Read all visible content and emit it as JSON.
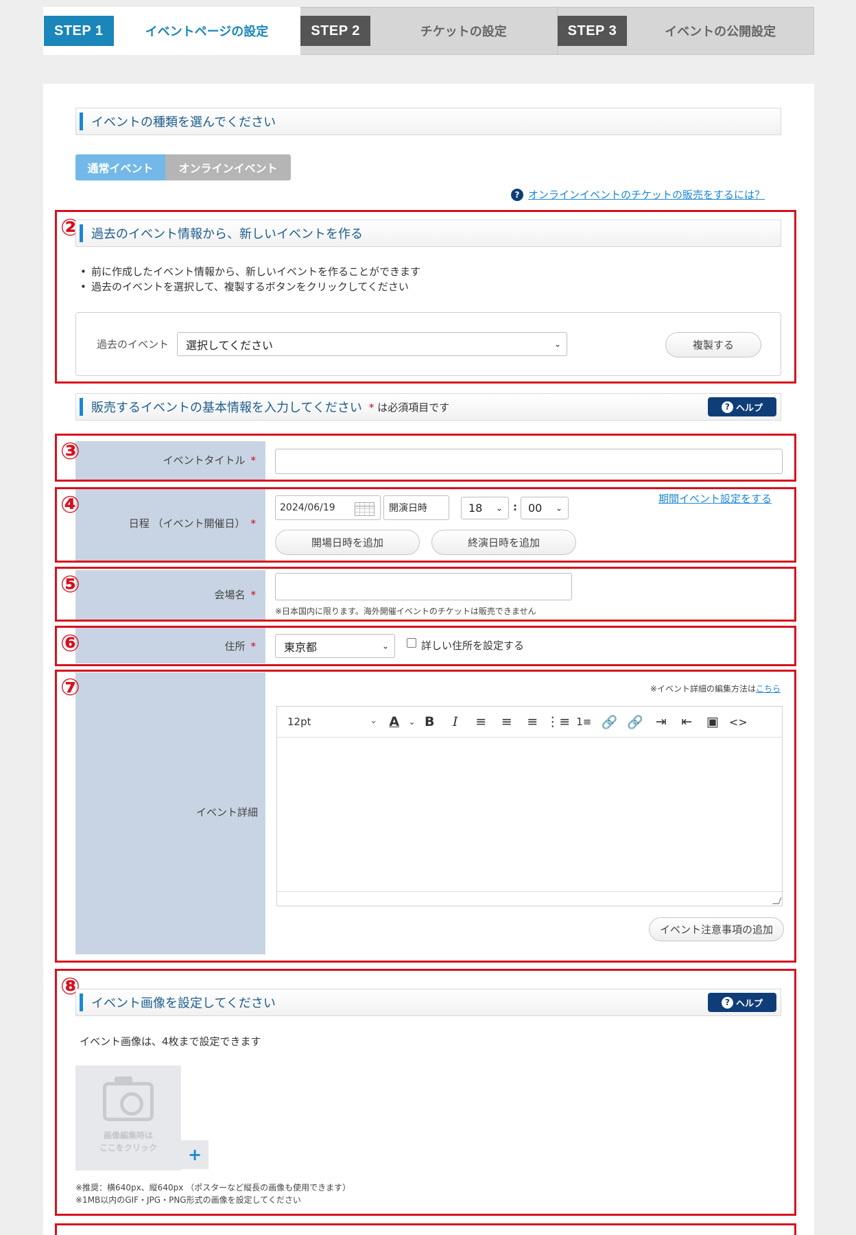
{
  "steps": [
    {
      "badge": "STEP 1",
      "label": "イベントページの設定"
    },
    {
      "badge": "STEP 2",
      "label": "チケットの設定"
    },
    {
      "badge": "STEP 3",
      "label": "イベントの公開設定"
    }
  ],
  "event_type": {
    "heading": "イベントの種類を選んでください",
    "options": [
      "通常イベント",
      "オンラインイベント"
    ],
    "help_link": "オンラインイベントのチケットの販売をするには？"
  },
  "annotations": [
    "②",
    "③",
    "④",
    "⑤",
    "⑥",
    "⑦",
    "⑧"
  ],
  "past_event": {
    "heading": "過去のイベント情報から、新しいイベントを作る",
    "bullets": [
      "前に作成したイベント情報から、新しいイベントを作ることができます",
      "過去のイベントを選択して、複製するボタンをクリックしてください"
    ],
    "label": "過去のイベント",
    "select_value": "選択してください",
    "copy_button": "複製する"
  },
  "basic_info": {
    "heading": "販売するイベントの基本情報を入力してください",
    "required_note_ast": "*",
    "required_note": "は必須項目です",
    "help": "ヘルプ"
  },
  "title_field": {
    "label": "イベントタイトル",
    "ast": "*",
    "value": ""
  },
  "date_field": {
    "label": "日程 （イベント開催日）",
    "ast": "*",
    "date": "2024/06/19",
    "time_label": "開演日時",
    "hour": "18",
    "colon": ":",
    "minute": "00",
    "period_link": "期間イベント設定をする",
    "add_open": "開場日時を追加",
    "add_end": "終演日時を追加"
  },
  "venue_field": {
    "label": "会場名",
    "ast": "*",
    "value": "",
    "note": "※日本国内に限ります。海外開催イベントのチケットは販売できません"
  },
  "address_field": {
    "label": "住所",
    "ast": "*",
    "prefecture": "東京都",
    "detail_checkbox": "詳しい住所を設定する"
  },
  "detail_field": {
    "label": "イベント詳細",
    "edit_note": "※イベント詳細の編集方法は",
    "edit_link": "こちら",
    "font_size": "12pt",
    "toolbar_icons": [
      "font-color-icon",
      "bold-icon",
      "italic-icon",
      "align-left-icon",
      "align-center-icon",
      "align-right-icon",
      "bullet-list-icon",
      "numbered-list-icon",
      "link-icon",
      "unlink-icon",
      "indent-icon",
      "outdent-icon",
      "image-icon",
      "code-icon"
    ],
    "add_notice": "イベント注意事項の追加"
  },
  "image_section": {
    "heading": "イベント画像を設定してください",
    "help": "ヘルプ",
    "desc": "イベント画像は、4枚まで設定できます",
    "placeholder_line1": "画像編集時は",
    "placeholder_line2": "ここをクリック",
    "note1": "※推奨：横640px、縦640px （ポスターなど縦長の画像も使用できます）",
    "note2": "※1MB以内のGIF・JPG・PNG形式の画像を設定してください"
  },
  "colors": {
    "accent": "#1a86b9",
    "annotation_red": "#d8101e",
    "label_bg": "#c8d4e3",
    "help_navy": "#0f3d78"
  }
}
